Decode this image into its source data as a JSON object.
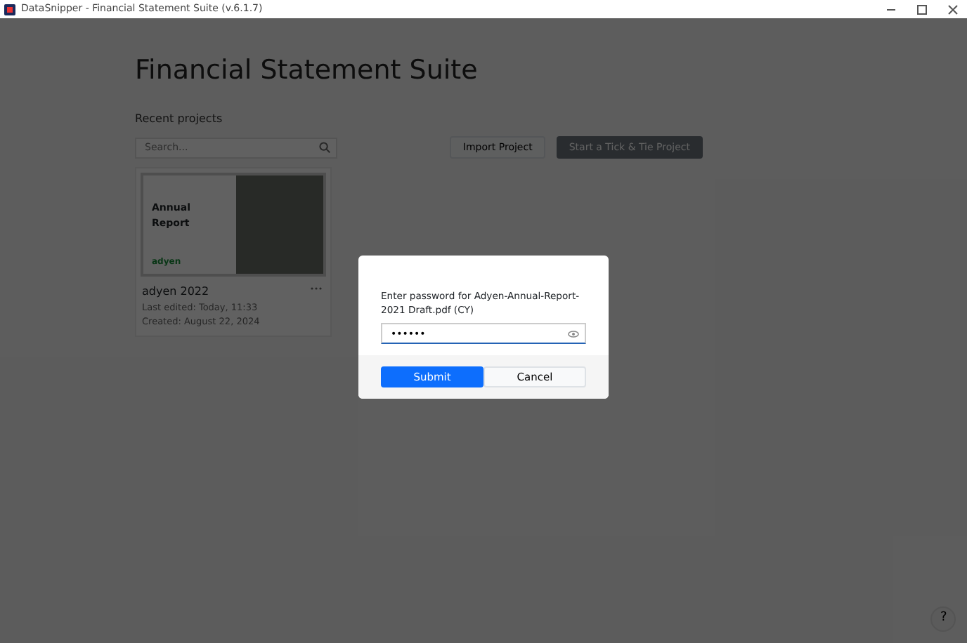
{
  "window": {
    "title": "DataSnipper - Financial Statement Suite (v.6.1.7)"
  },
  "heading": "Financial Statement Suite",
  "recent_label": "Recent projects",
  "search": {
    "placeholder": "Search..."
  },
  "buttons": [
    {
      "label": "Import Project",
      "kind": "secondary"
    },
    {
      "label": "Start a Tick & Tie Project",
      "kind": "primary"
    }
  ],
  "projects": [
    {
      "cover_title": "Annual Report",
      "cover_brand": "adyen",
      "name": "adyen 2022",
      "edited": "Last edited: Today, 11:33",
      "created": "Created: August 22, 2024"
    }
  ],
  "dialog": {
    "prompt": "Enter password for Adyen-Annual-Report-2021 Draft.pdf (CY)",
    "value": "••••••",
    "buttons": [
      {
        "label": "Submit",
        "kind": "primary"
      },
      {
        "label": "Cancel",
        "kind": "secondary"
      }
    ]
  },
  "help": "?"
}
